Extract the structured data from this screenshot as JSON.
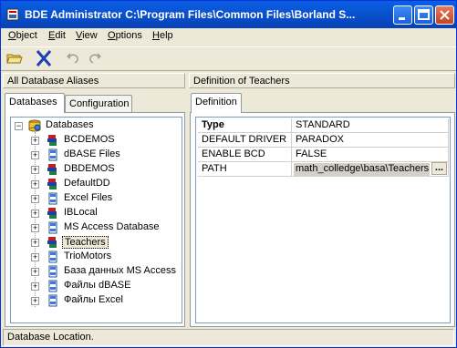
{
  "window": {
    "title": "BDE Administrator  C:\\Program Files\\Common Files\\Borland S..."
  },
  "menu": [
    "Object",
    "Edit",
    "View",
    "Options",
    "Help"
  ],
  "toolbar": {
    "icons": [
      "open-folder-icon",
      "delete-x-icon",
      "undo-icon",
      "redo-icon"
    ]
  },
  "left_pane": {
    "header": "All Database Aliases",
    "tabs": [
      "Databases",
      "Configuration"
    ],
    "tree": {
      "root": "Databases",
      "items": [
        {
          "label": "BCDEMOS",
          "icon": "database-alias-icon"
        },
        {
          "label": "dBASE Files",
          "icon": "odbc-alias-icon"
        },
        {
          "label": "DBDEMOS",
          "icon": "database-alias-icon"
        },
        {
          "label": "DefaultDD",
          "icon": "database-alias-icon"
        },
        {
          "label": "Excel Files",
          "icon": "odbc-alias-icon"
        },
        {
          "label": "IBLocal",
          "icon": "database-alias-icon"
        },
        {
          "label": "MS Access Database",
          "icon": "odbc-alias-icon"
        },
        {
          "label": "Teachers",
          "icon": "database-alias-icon",
          "selected": true
        },
        {
          "label": "TrioMotors",
          "icon": "odbc-alias-icon"
        },
        {
          "label": "База данных MS Access",
          "icon": "odbc-alias-icon"
        },
        {
          "label": "Файлы dBASE",
          "icon": "odbc-alias-icon"
        },
        {
          "label": "Файлы Excel",
          "icon": "odbc-alias-icon"
        }
      ]
    }
  },
  "right_pane": {
    "header": "Definition of Teachers",
    "tab": "Definition",
    "properties": [
      {
        "name": "Type",
        "value": "STANDARD",
        "bold": true
      },
      {
        "name": "DEFAULT DRIVER",
        "value": "PARADOX"
      },
      {
        "name": "ENABLE BCD",
        "value": "FALSE"
      },
      {
        "name": "PATH",
        "value": "math_colledge\\basa\\Teachers",
        "editing": true
      }
    ],
    "ellipsis_button": "..."
  },
  "status": {
    "text": "Database Location."
  }
}
